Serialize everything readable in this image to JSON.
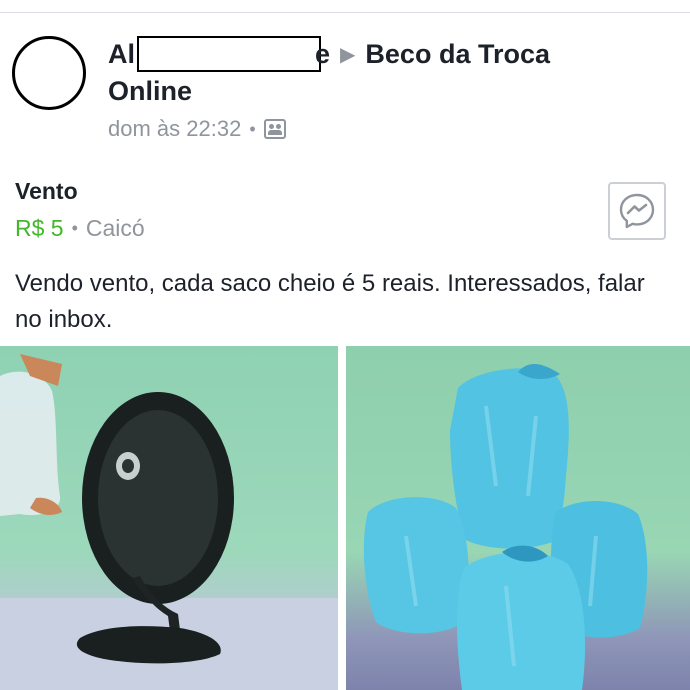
{
  "post": {
    "author_prefix": "Al",
    "author_suffix": "e",
    "group_line1": "Beco da Troca",
    "group_line2": "Online",
    "timestamp": "dom às 22:32",
    "separator": "•",
    "audience_icon": "group-icon"
  },
  "listing": {
    "title": "Vento",
    "price": "R$ 5",
    "separator": "•",
    "location": "Caicó",
    "message_icon": "messenger-icon",
    "description": "Vendo vento, cada saco cheio é 5 reais. Interessados, falar no inbox."
  },
  "colors": {
    "price_green": "#42b72a",
    "meta_gray": "#90949c",
    "text": "#1d2129"
  },
  "photos": [
    {
      "subject": "table-fan"
    },
    {
      "subject": "blue-plastic-bags"
    }
  ]
}
